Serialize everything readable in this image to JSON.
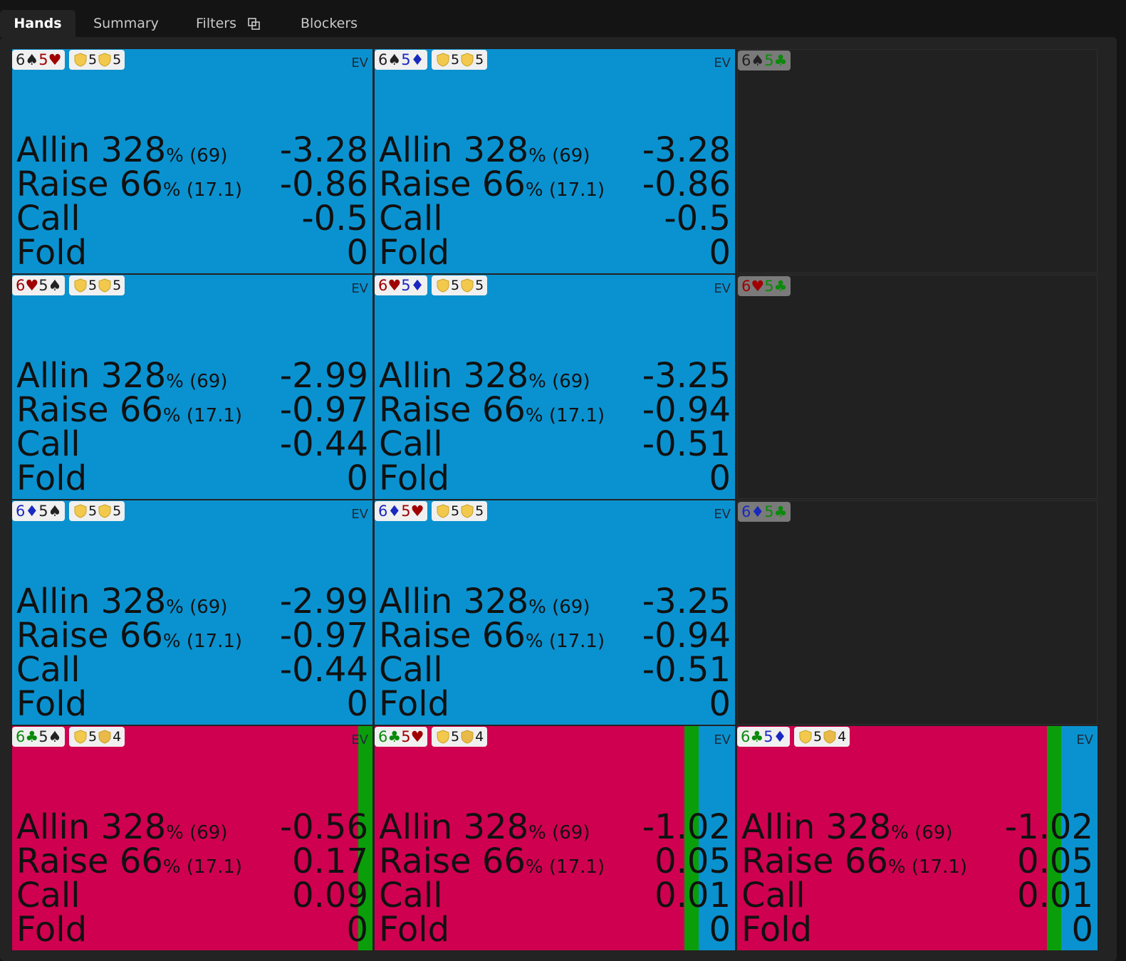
{
  "tabs": [
    {
      "label": "Hands",
      "active": true
    },
    {
      "label": "Summary",
      "active": false
    },
    {
      "label": "Filters",
      "active": false,
      "icon": "copy-icon"
    },
    {
      "label": "Blockers",
      "active": false
    }
  ],
  "colors": {
    "allin": "#d00050",
    "raise": "#0a9f0a",
    "call": "#0a92d0",
    "card_spade": "#222222",
    "card_heart": "#a00000",
    "card_diamond": "#1a28c0",
    "card_club": "#0a8a0a",
    "badge_shield": "#f2c94c"
  },
  "ev_label": "EV",
  "actions": [
    {
      "name": "Allin",
      "size": "328",
      "pct_text": "% (69)"
    },
    {
      "name": "Raise",
      "size": "66",
      "pct_text": "% (17.1)"
    },
    {
      "name": "Call",
      "size": "",
      "pct_text": ""
    },
    {
      "name": "Fold",
      "size": "",
      "pct_text": ""
    }
  ],
  "hands": [
    {
      "c1": "6",
      "s1": "spade",
      "c2": "5",
      "s2": "heart",
      "badge": [
        "5",
        "5"
      ],
      "evs": [
        "-3.28",
        "-0.86",
        "-0.5",
        "0"
      ],
      "freq": {
        "allin": 0,
        "raise": 0,
        "call": 1
      }
    },
    {
      "c1": "6",
      "s1": "spade",
      "c2": "5",
      "s2": "diamond",
      "badge": [
        "5",
        "5"
      ],
      "evs": [
        "-3.28",
        "-0.86",
        "-0.5",
        "0"
      ],
      "freq": {
        "allin": 0,
        "raise": 0,
        "call": 1
      }
    },
    {
      "c1": "6",
      "s1": "spade",
      "c2": "5",
      "s2": "club",
      "empty": true
    },
    {
      "c1": "6",
      "s1": "heart",
      "c2": "5",
      "s2": "spade",
      "badge": [
        "5",
        "5"
      ],
      "evs": [
        "-2.99",
        "-0.97",
        "-0.44",
        "0"
      ],
      "freq": {
        "allin": 0,
        "raise": 0,
        "call": 1
      }
    },
    {
      "c1": "6",
      "s1": "heart",
      "c2": "5",
      "s2": "diamond",
      "badge": [
        "5",
        "5"
      ],
      "evs": [
        "-3.25",
        "-0.94",
        "-0.51",
        "0"
      ],
      "freq": {
        "allin": 0,
        "raise": 0,
        "call": 1
      }
    },
    {
      "c1": "6",
      "s1": "heart",
      "c2": "5",
      "s2": "club",
      "empty": true
    },
    {
      "c1": "6",
      "s1": "diamond",
      "c2": "5",
      "s2": "spade",
      "badge": [
        "5",
        "5"
      ],
      "evs": [
        "-2.99",
        "-0.97",
        "-0.44",
        "0"
      ],
      "freq": {
        "allin": 0,
        "raise": 0,
        "call": 1
      }
    },
    {
      "c1": "6",
      "s1": "diamond",
      "c2": "5",
      "s2": "heart",
      "badge": [
        "5",
        "5"
      ],
      "evs": [
        "-3.25",
        "-0.94",
        "-0.51",
        "0"
      ],
      "freq": {
        "allin": 0,
        "raise": 0,
        "call": 1
      }
    },
    {
      "c1": "6",
      "s1": "diamond",
      "c2": "5",
      "s2": "club",
      "empty": true
    },
    {
      "c1": "6",
      "s1": "club",
      "c2": "5",
      "s2": "spade",
      "badge": [
        "5",
        "4"
      ],
      "evs": [
        "-0.56",
        "0.17",
        "0.09",
        "0"
      ],
      "freq": {
        "allin": 0.96,
        "raise": 0.04,
        "call": 0
      }
    },
    {
      "c1": "6",
      "s1": "club",
      "c2": "5",
      "s2": "heart",
      "badge": [
        "5",
        "4"
      ],
      "evs": [
        "-1.02",
        "0.05",
        "0.01",
        "0"
      ],
      "freq": {
        "allin": 0.86,
        "raise": 0.04,
        "call": 0.1
      }
    },
    {
      "c1": "6",
      "s1": "club",
      "c2": "5",
      "s2": "diamond",
      "badge": [
        "5",
        "4"
      ],
      "evs": [
        "-1.02",
        "0.05",
        "0.01",
        "0"
      ],
      "freq": {
        "allin": 0.86,
        "raise": 0.04,
        "call": 0.1
      }
    }
  ]
}
